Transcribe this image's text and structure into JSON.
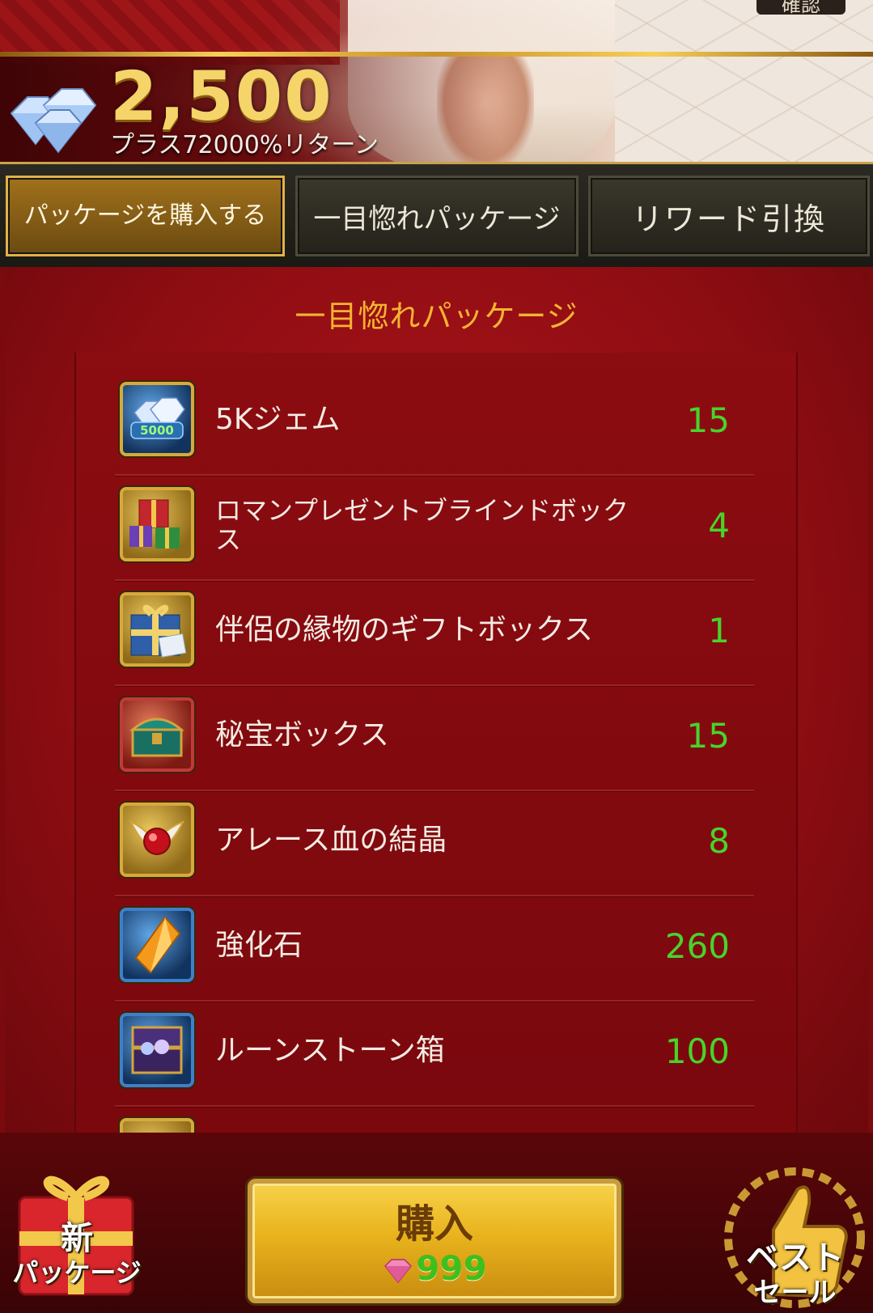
{
  "header": {
    "confirm_label": "確認",
    "gem_amount": "2,500",
    "bonus_text": "プラス72000%リターン",
    "icon": "diamond-cluster-icon"
  },
  "tabs": [
    {
      "label": "パッケージを購入する",
      "active": true
    },
    {
      "label": "一目惚れパッケージ",
      "active": false
    },
    {
      "label": "リワード引換",
      "active": false
    }
  ],
  "package": {
    "title": "一目惚れパッケージ",
    "items": [
      {
        "name": "5Kジェム",
        "qty": "15",
        "icon": "gem-5000-icon",
        "icon_badge": "5000"
      },
      {
        "name": "ロマンプレゼントブラインドボックス",
        "qty": "4",
        "icon": "gift-pile-icon"
      },
      {
        "name": "伴侶の縁物のギフトボックス",
        "qty": "1",
        "icon": "blue-gift-box-icon"
      },
      {
        "name": "秘宝ボックス",
        "qty": "15",
        "icon": "treasure-chest-icon"
      },
      {
        "name": "アレース血の結晶",
        "qty": "8",
        "icon": "blood-crystal-icon"
      },
      {
        "name": "強化石",
        "qty": "260",
        "icon": "enhance-stone-icon"
      },
      {
        "name": "ルーンストーン箱",
        "qty": "100",
        "icon": "rune-chest-icon"
      }
    ]
  },
  "buy": {
    "label": "購入",
    "price": "999",
    "currency_icon": "pink-gem-icon"
  },
  "side_buttons": {
    "new_package": "新\nパッケージ",
    "new_package_top": "新",
    "new_package_bottom": "パッケージ",
    "best_sale_top": "ベスト",
    "best_sale_bottom": "セール"
  },
  "colors": {
    "accent_gold": "#f5d46a",
    "title_orange": "#f5b331",
    "qty_green": "#47d42a",
    "panel_red": "#8d0d12"
  }
}
